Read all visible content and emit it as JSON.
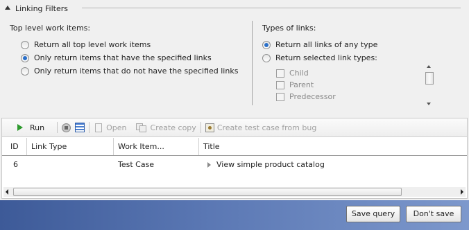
{
  "filters": {
    "section_title": "Linking Filters",
    "top_level": {
      "label": "Top level work items:",
      "options": [
        {
          "label": "Return all top level work items",
          "checked": false
        },
        {
          "label": "Only return items that have the specified links",
          "checked": true
        },
        {
          "label": "Only return items that do not have the specified links",
          "checked": false
        }
      ]
    },
    "link_types": {
      "label": "Types of links:",
      "options": [
        {
          "label": "Return all links of any type",
          "checked": true
        },
        {
          "label": "Return selected link types:",
          "checked": false
        }
      ],
      "checkboxes": [
        {
          "label": "Child",
          "checked": false
        },
        {
          "label": "Parent",
          "checked": false
        },
        {
          "label": "Predecessor",
          "checked": false
        }
      ]
    }
  },
  "toolbar": {
    "run_label": "Run",
    "open_label": "Open",
    "copy_label": "Create copy",
    "bug_label": "Create test case from bug"
  },
  "grid": {
    "columns": [
      "ID",
      "Link Type",
      "Work Item...",
      "Title"
    ],
    "rows": [
      {
        "id": "6",
        "link_type": "",
        "work_item": "Test Case",
        "title": "View simple product catalog"
      }
    ]
  },
  "footer": {
    "save_label": "Save query",
    "dont_save_label": "Don't save"
  }
}
